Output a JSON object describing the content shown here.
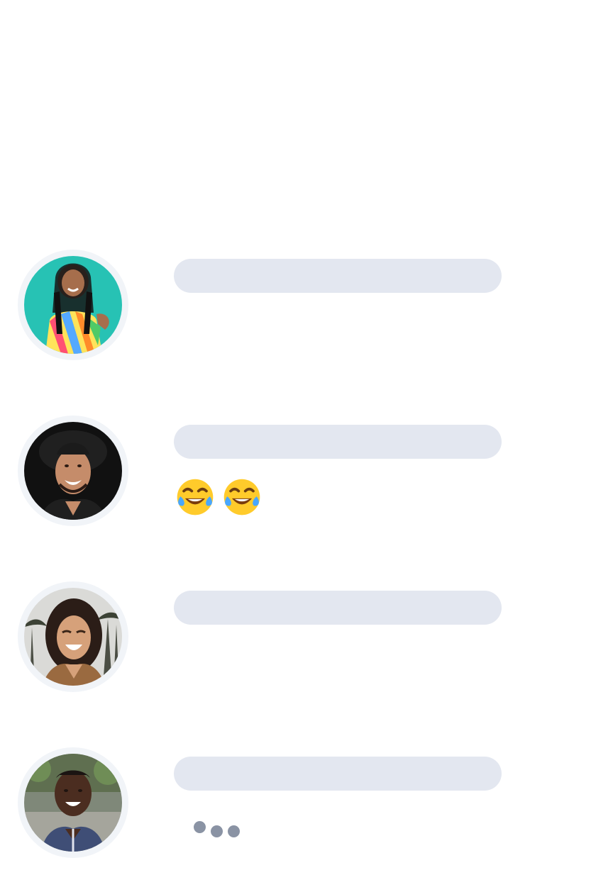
{
  "feed": {
    "items": [
      {
        "avatar_icon": "person-photo-colorful-shirt",
        "message_type": "none"
      },
      {
        "avatar_icon": "person-photo-black-hat",
        "message_type": "emoji",
        "emojis": [
          "😂",
          "😂"
        ],
        "emoji_icon": "face-with-tears-of-joy-icon"
      },
      {
        "avatar_icon": "person-photo-palm-trees",
        "message_type": "none"
      },
      {
        "avatar_icon": "person-photo-outdoor",
        "message_type": "typing",
        "typing_indicator_dots": 3
      }
    ]
  },
  "colors": {
    "skeleton_bar": "#e3e7f0",
    "avatar_ring": "#f1f4f8",
    "typing_dot": "#8a93a4"
  }
}
